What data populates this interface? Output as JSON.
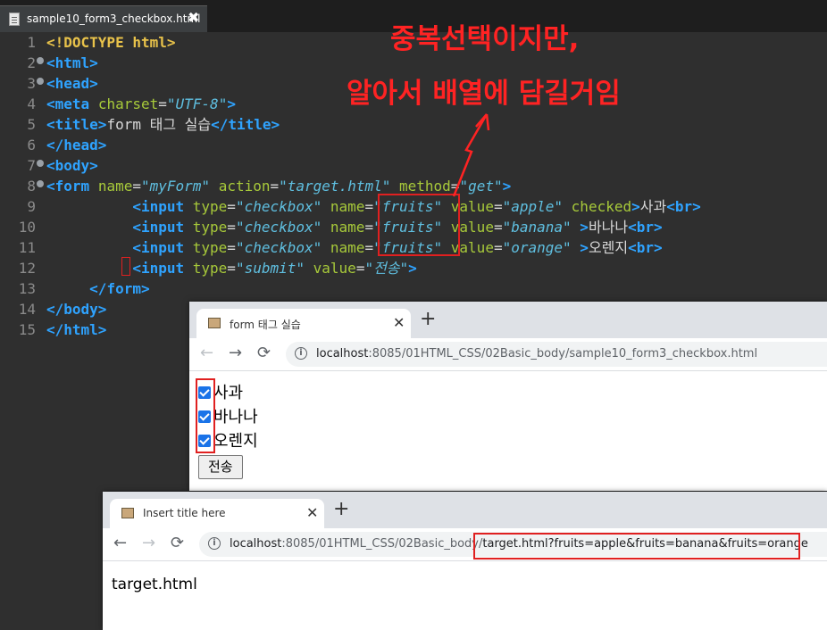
{
  "editor": {
    "tab_label": "sample10_form3_checkbox.html",
    "tab_close": "✖",
    "line_numbers": [
      "1",
      "2",
      "3",
      "4",
      "5",
      "6",
      "7",
      "8",
      "9",
      "10",
      "11",
      "12",
      "13",
      "14",
      "15"
    ],
    "lines": {
      "l1": {
        "doctype": "<!DOCTYPE",
        "html": "html>"
      },
      "l2": "<html>",
      "l3": "<head>",
      "l4": {
        "open": "<meta",
        "attr": "charset",
        "eq": "=",
        "val": "\"UTF-8\"",
        "close": ">"
      },
      "l5": {
        "open": "<title>",
        "text": "form 태그 실습",
        "close": "</title>"
      },
      "l6": "</head>",
      "l7": "<body>",
      "l8": {
        "open": "<form",
        "a1": "name",
        "v1": "\"myForm\"",
        "a2": "action",
        "v2": "\"target.html\"",
        "a3": "method",
        "v3": "\"get\"",
        "close": ">"
      },
      "l9": {
        "open": "<input",
        "type_attr": "type",
        "type_val": "\"checkbox\"",
        "name_attr": "name",
        "name_val": "\"fruits\"",
        "value_attr": "value",
        "value_val": "\"apple\"",
        "checked": "checked",
        "text": "사과",
        "br": "<br>"
      },
      "l10": {
        "open": "<input",
        "type_attr": "type",
        "type_val": "\"checkbox\"",
        "name_attr": "name",
        "name_val": "\"fruits\"",
        "value_attr": "value",
        "value_val": "\"banana\"",
        "text": "바나나",
        "br": "<br>"
      },
      "l11": {
        "open": "<input",
        "type_attr": "type",
        "type_val": "\"checkbox\"",
        "name_attr": "name",
        "name_val": "\"fruits\"",
        "value_attr": "value",
        "value_val": "\"orange\"",
        "text": "오렌지",
        "br": "<br>"
      },
      "l12": {
        "open": "<input",
        "type_attr": "type",
        "type_val": "\"submit\"",
        "value_attr": "value",
        "value_val": "\"전송\"",
        "close": ">"
      },
      "l13": "</form>",
      "l14": "</body>",
      "l15": "</html>"
    }
  },
  "annotation": {
    "line1": "중복선택이지만,",
    "line2": "알아서 배열에 담길거임",
    "color": "#ff2323"
  },
  "browser1": {
    "tab_title": "form 태그 실습",
    "close": "✕",
    "new_tab": "+",
    "url_host": "localhost",
    "url_path": ":8085/01HTML_CSS/02Basic_body/sample10_form3_checkbox.html",
    "checkboxes": [
      {
        "label": "사과",
        "checked": true
      },
      {
        "label": "바나나",
        "checked": true
      },
      {
        "label": "오렌지",
        "checked": true
      }
    ],
    "submit_label": "전송"
  },
  "browser2": {
    "tab_title": "Insert title here",
    "close": "✕",
    "new_tab": "+",
    "url_host": "localhost",
    "url_path_a": ":8085/01HTML_CSS/02Basic_body/",
    "url_path_b": "target.html?fruits=apple&fruits=banana&fruits=orange",
    "page_text": "target.html"
  },
  "icons": {
    "back": "←",
    "forward": "→",
    "reload": "⟳",
    "info": "i"
  },
  "colors": {
    "highlight": "#e02020",
    "checkbox": "#1a73e8",
    "tag": "#2fa3ff",
    "attribute": "#a7c93a",
    "string": "#5fbfe0"
  }
}
